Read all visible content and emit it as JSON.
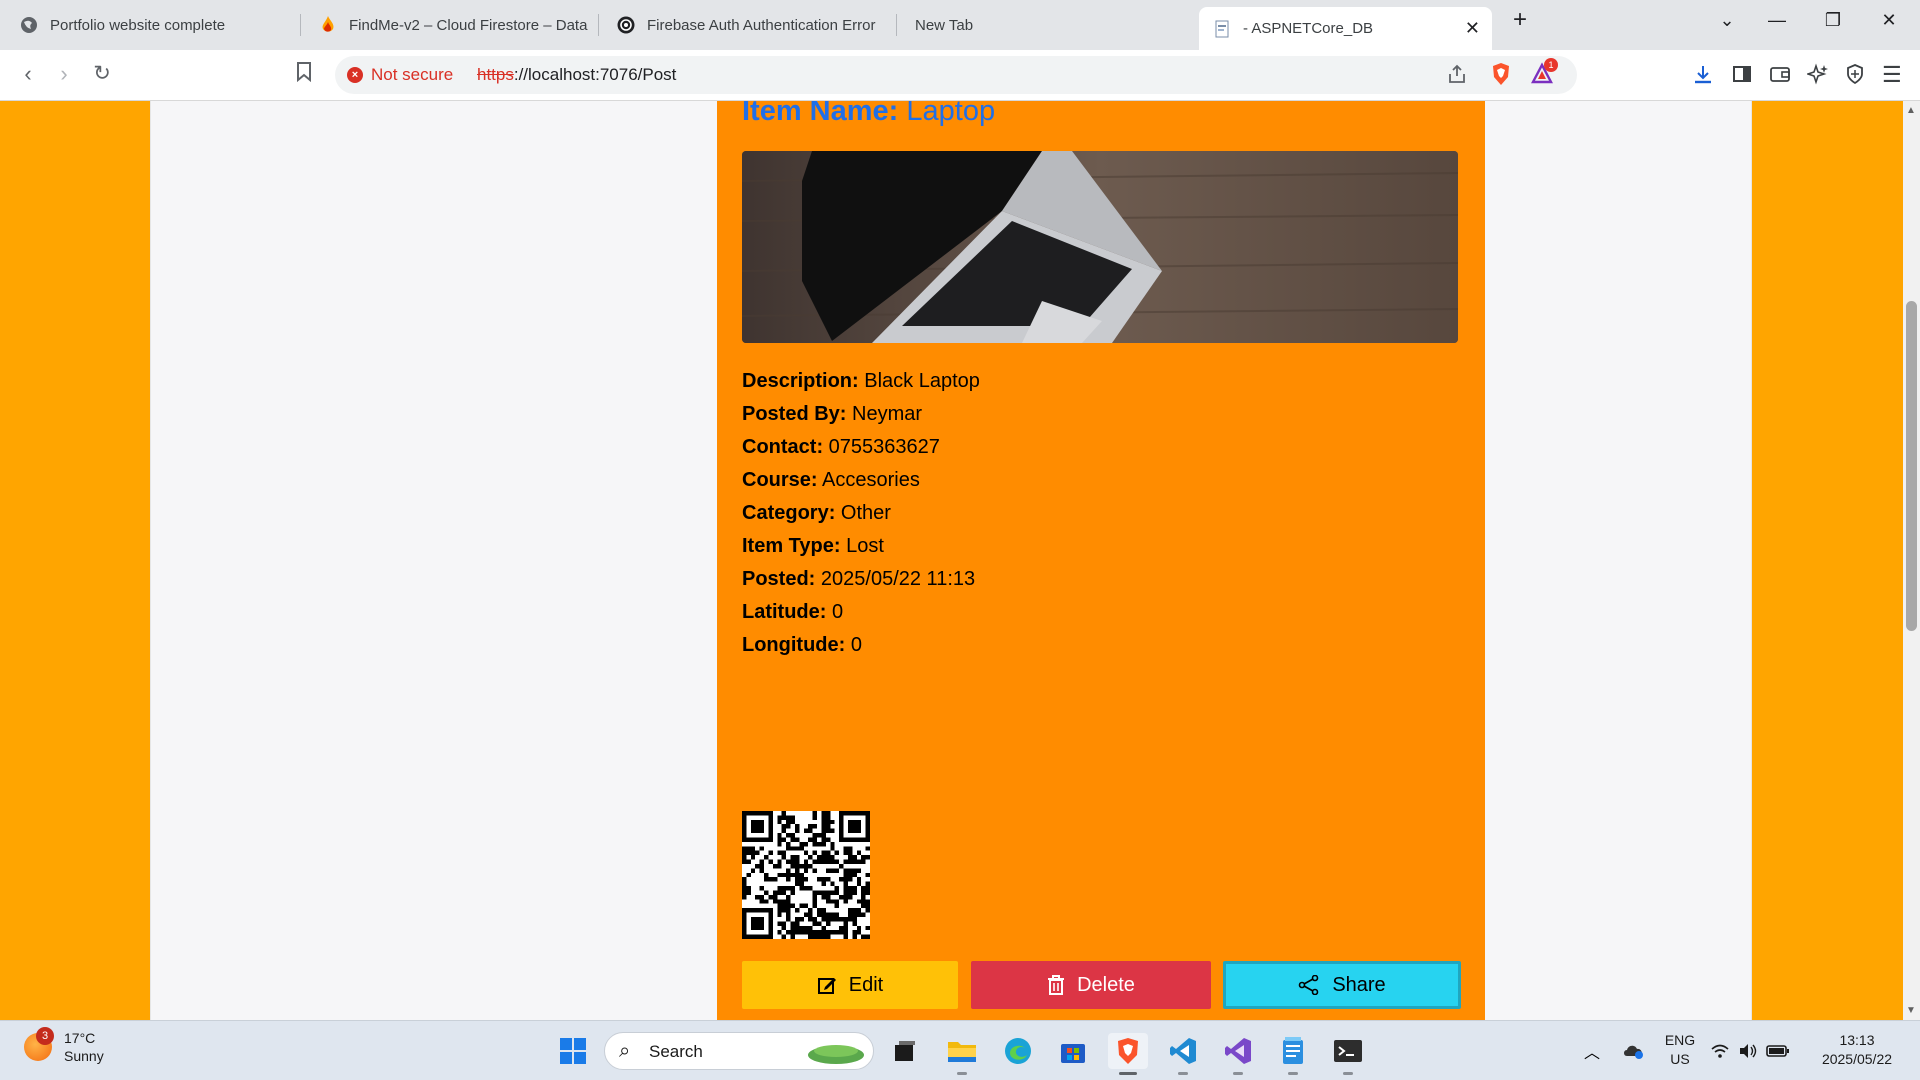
{
  "browser": {
    "tabs": [
      {
        "title": "Portfolio website complete",
        "icon": "globe-icon"
      },
      {
        "title": "FindMe-v2 – Cloud Firestore – Data",
        "icon": "firebase-icon"
      },
      {
        "title": "Firebase Auth Authentication Error",
        "icon": "openai-icon"
      },
      {
        "title": "New Tab",
        "icon": ""
      },
      {
        "title": "- ASPNETCore_DB",
        "icon": "page-icon",
        "active": true
      }
    ],
    "new_tab": "+",
    "security_label": "Not secure",
    "url_scheme": "https",
    "url_rest": "://localhost:7076/Post",
    "rewards_badge": "1"
  },
  "post": {
    "title_label": "Item Name:",
    "title_value": "Laptop",
    "image_alt": "laptop-photo",
    "details": [
      {
        "label": "Description:",
        "value": "Black Laptop"
      },
      {
        "label": "Posted By:",
        "value": "Neymar"
      },
      {
        "label": "Contact:",
        "value": "0755363627"
      },
      {
        "label": "Course:",
        "value": "Accesories"
      },
      {
        "label": "Category:",
        "value": "Other"
      },
      {
        "label": "Item Type:",
        "value": "Lost"
      },
      {
        "label": "Posted:",
        "value": "2025/05/22 11:13"
      },
      {
        "label": "Latitude:",
        "value": "0"
      },
      {
        "label": "Longitude:",
        "value": "0"
      }
    ],
    "buttons": {
      "edit": "Edit",
      "delete": "Delete",
      "share": "Share"
    }
  },
  "taskbar": {
    "weather_temp": "17°C",
    "weather_desc": "Sunny",
    "weather_badge": "3",
    "search_label": "Search",
    "lang_top": "ENG",
    "lang_bottom": "US",
    "time": "13:13",
    "date": "2025/05/22"
  },
  "colors": {
    "page_bg": "#ffa500",
    "card_bg": "#ff8c00",
    "title": "#1f6fe8",
    "edit": "#ffc107",
    "delete": "#dc3545",
    "share": "#27d3f0"
  }
}
